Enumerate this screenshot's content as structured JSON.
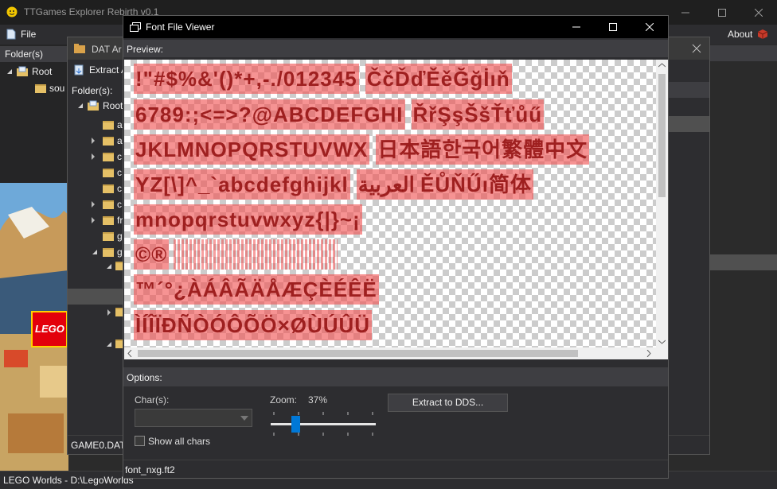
{
  "main_window": {
    "title": "TTGames Explorer Rebirth v0.1",
    "menu": {
      "file": "File",
      "about": "About"
    },
    "folders_header": "Folder(s)",
    "tree_root": "Root",
    "tree_child": "sou",
    "logo_text": "LEGO",
    "status": "LEGO Worlds - D:\\LegoWorlds"
  },
  "dat_window": {
    "title": "DAT Ar",
    "extract_label": "Extract A",
    "folders_header": "Folder(s):",
    "tree_root": "Root",
    "tree_items": [
      "a",
      "a",
      "c",
      "c",
      "c",
      "c",
      "fr",
      "g",
      "g"
    ],
    "status": "GAME0.DAT"
  },
  "font_viewer": {
    "title": "Font File Viewer",
    "preview_label": "Preview:",
    "options_label": "Options:",
    "chars_label": "Char(s):",
    "chars_value": "",
    "zoom_label": "Zoom:",
    "zoom_value": "37%",
    "zoom_level": 0.37,
    "extract_button": "Extract to DDS...",
    "show_all_label": "Show all chars",
    "show_all_checked": false,
    "status": "font_nxg.ft2",
    "glyph_rows": [
      {
        "main": "!\"#$%&'()*+,-./012345",
        "extra": "ČčĎďĚěĞğİıň"
      },
      {
        "main": "6789:;<=>?@ABCDEFGHI",
        "extra": "ŘřŞşŠšŤťůű"
      },
      {
        "main": "JKLMNOPQRSTUVWX",
        "extra": "日本語한국어繁體中文"
      },
      {
        "main": "YZ[\\]^_`abcdefghijkl",
        "extra": "العربية ĚŮŇŰı简体"
      },
      {
        "main": "mnopqrstuvwxyz{|}~¡",
        "extra": ""
      },
      {
        "main": "©®",
        "extra": ""
      },
      {
        "main": "™´°¿ÀÁÂÃÄÅÆÇÈÉÊË",
        "extra": ""
      },
      {
        "main": "ÌÍÎÏÐÑÒÓÔÕÖ×ØÙÚÛÜ",
        "extra": ""
      }
    ]
  },
  "colors": {
    "accent": "#0078d7",
    "glyph_fill": "#f05050",
    "background": "#2b2b2b",
    "titlebar": "#000000"
  }
}
